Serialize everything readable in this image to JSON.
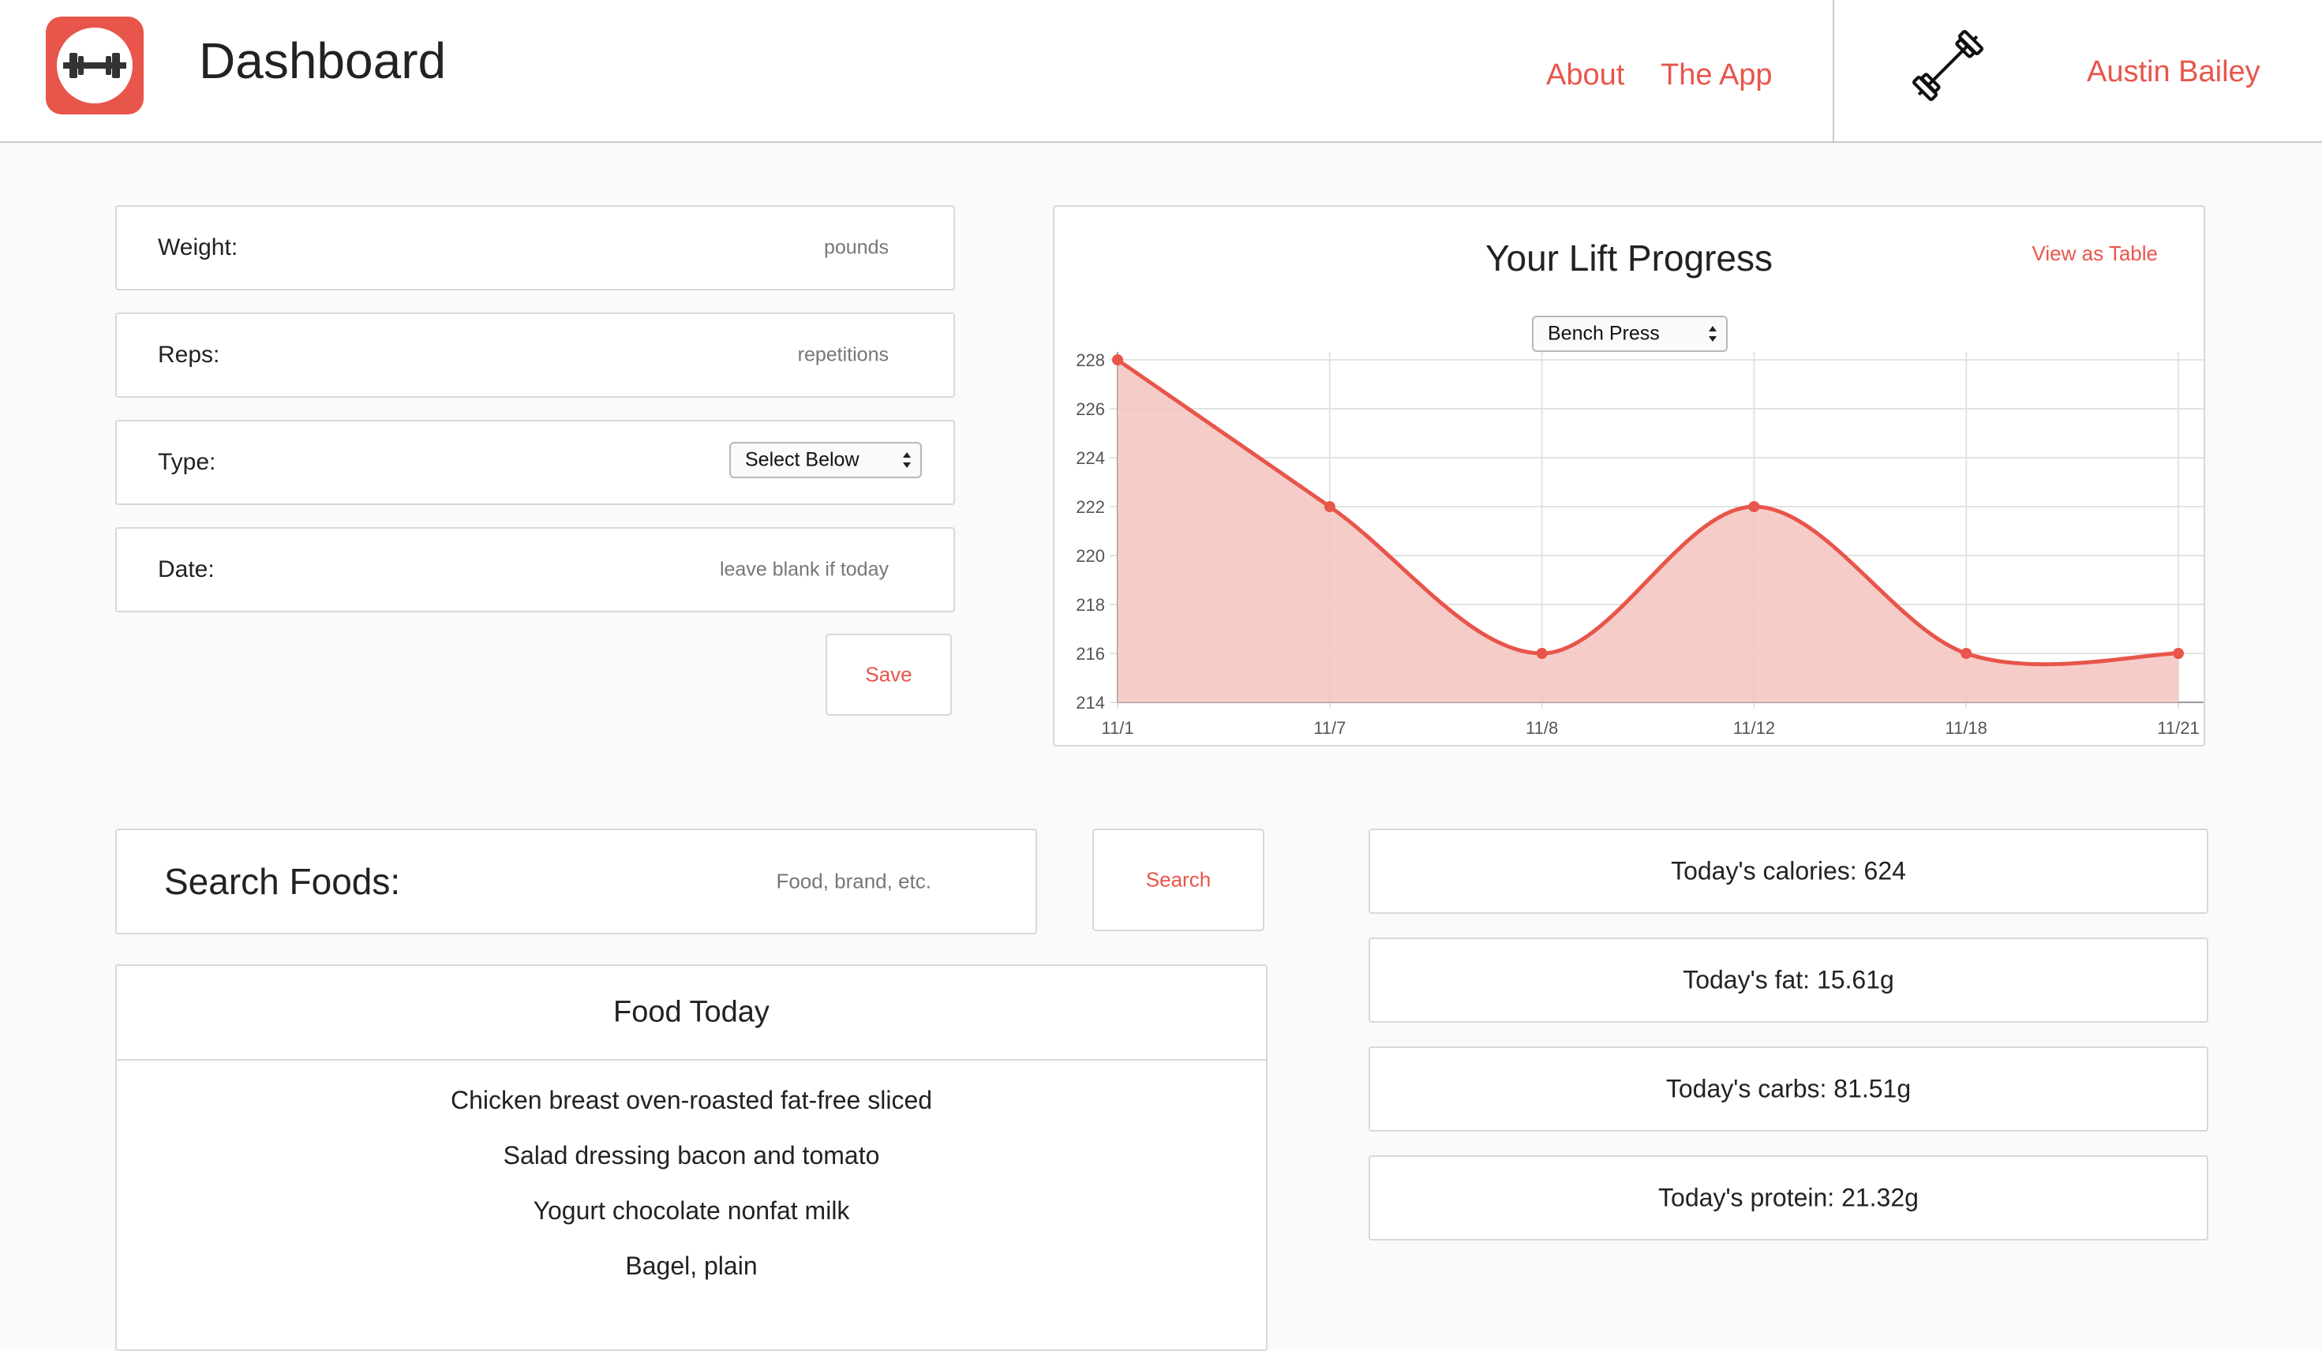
{
  "header": {
    "title": "Dashboard",
    "nav": [
      "About",
      "The App"
    ],
    "user_name": "Austin Bailey",
    "accent_color": "#e8554a"
  },
  "form": {
    "weight": {
      "label": "Weight:",
      "placeholder": "pounds"
    },
    "reps": {
      "label": "Reps:",
      "placeholder": "repetitions"
    },
    "type": {
      "label": "Type:",
      "selected": "Select Below"
    },
    "date": {
      "label": "Date:",
      "placeholder": "leave blank if today"
    },
    "save_label": "Save"
  },
  "chart_panel": {
    "title": "Your Lift Progress",
    "view_table_label": "View as Table",
    "exercise_selected": "Bench Press"
  },
  "chart_data": {
    "type": "area",
    "title": "Your Lift Progress",
    "categories": [
      "11/1",
      "11/7",
      "11/8",
      "11/12",
      "11/18",
      "11/21"
    ],
    "values": [
      228,
      222,
      216,
      222,
      216,
      216
    ],
    "ylim": [
      214,
      228
    ],
    "yticks": [
      214,
      216,
      218,
      220,
      222,
      224,
      226,
      228
    ],
    "xlabel": "",
    "ylabel": "",
    "grid": true,
    "color": "#e8554a",
    "fill_color": "#f5c3c0"
  },
  "food_search": {
    "label": "Search Foods:",
    "placeholder": "Food, brand, etc.",
    "button_label": "Search"
  },
  "food_today": {
    "title": "Food Today",
    "items": [
      "Chicken breast oven-roasted fat-free sliced",
      "Salad dressing bacon and tomato",
      "Yogurt chocolate nonfat milk",
      "Bagel, plain"
    ]
  },
  "stats": {
    "calories": "Today's calories: 624",
    "fat": "Today's fat: 15.61g",
    "carbs": "Today's carbs: 81.51g",
    "protein": "Today's protein: 21.32g"
  }
}
